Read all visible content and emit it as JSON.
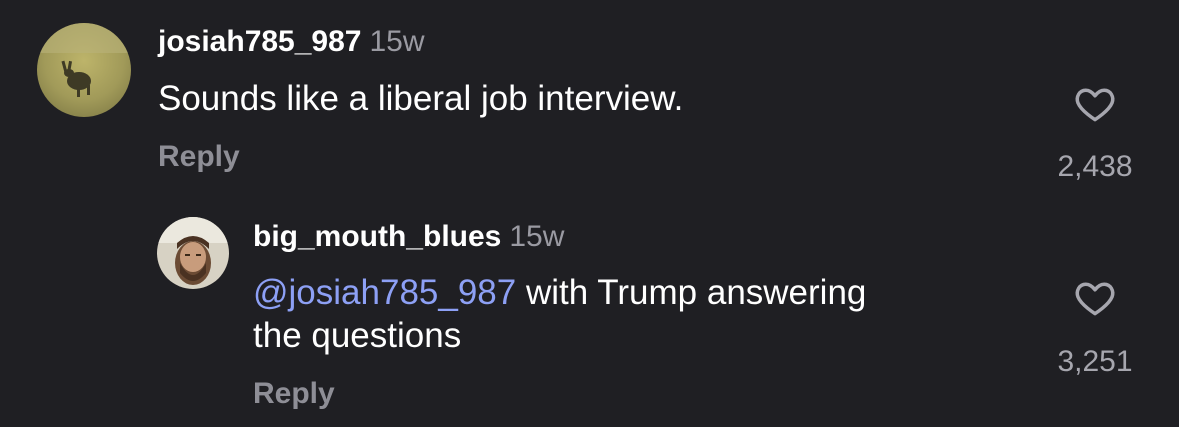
{
  "comments": [
    {
      "username": "josiah785_987",
      "time": "15w",
      "text": "Sounds like a liberal job interview.",
      "reply_label": "Reply",
      "like_count": "2,438",
      "avatar": "rabbit-in-field-photo"
    },
    {
      "username": "big_mouth_blues",
      "time": "15w",
      "mention": "@josiah785_987",
      "text_line1": " with Trump answering",
      "text_line2": "the questions",
      "reply_label": "Reply",
      "like_count": "3,251",
      "avatar": "bearded-man-photo"
    }
  ],
  "colors": {
    "background": "#1f1f23",
    "mention": "#8da0f5",
    "muted": "#8e8e96"
  },
  "icons": [
    "heart-outline-icon"
  ]
}
